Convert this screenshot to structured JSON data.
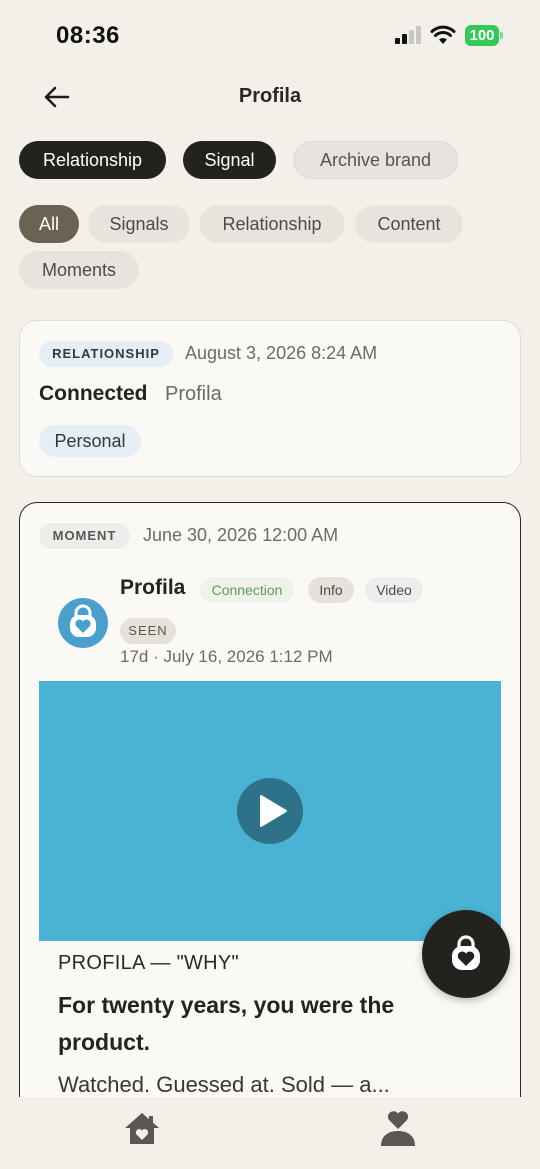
{
  "status": {
    "time": "08:36",
    "battery": "100"
  },
  "header": {
    "title": "Profila"
  },
  "top_chips": [
    {
      "label": "Relationship",
      "active": true
    },
    {
      "label": "Signal",
      "active": true
    },
    {
      "label": "Archive brand",
      "active": false
    }
  ],
  "filters": [
    {
      "label": "All",
      "active": true
    },
    {
      "label": "Signals",
      "active": false
    },
    {
      "label": "Relationship",
      "active": false
    },
    {
      "label": "Content",
      "active": false
    },
    {
      "label": "Moments",
      "active": false
    }
  ],
  "card1": {
    "type_badge": "RELATIONSHIP",
    "date": "August 3, 2026 8:24 AM",
    "status": "Connected",
    "brand": "Profila",
    "tag": "Personal"
  },
  "card2": {
    "type_badge": "MOMENT",
    "date": "June 30, 2026 12:00 AM",
    "sender": "Profila",
    "tags": [
      "Connection",
      "Info",
      "Video"
    ],
    "seen_badge": "SEEN",
    "meta": "17d · July 16, 2026 1:12 PM",
    "kicker": "PROFILA — \"WHY\"",
    "headline": "For twenty years, you were the product.",
    "body": "Watched. Guessed at. Sold — a..."
  },
  "colors": {
    "background": "#f3f0ea",
    "dark_chip": "#24221f",
    "active_filter": "#6a6354",
    "video": "#4ab2d2",
    "avatar": "#4a9fcb",
    "connection_tag": "#5f9b5c"
  },
  "icons": {
    "back": "arrow-left-icon",
    "play": "play-icon",
    "fab": "heart-lock-icon",
    "tab_home": "home-heart-icon",
    "tab_profile": "person-heart-icon"
  }
}
